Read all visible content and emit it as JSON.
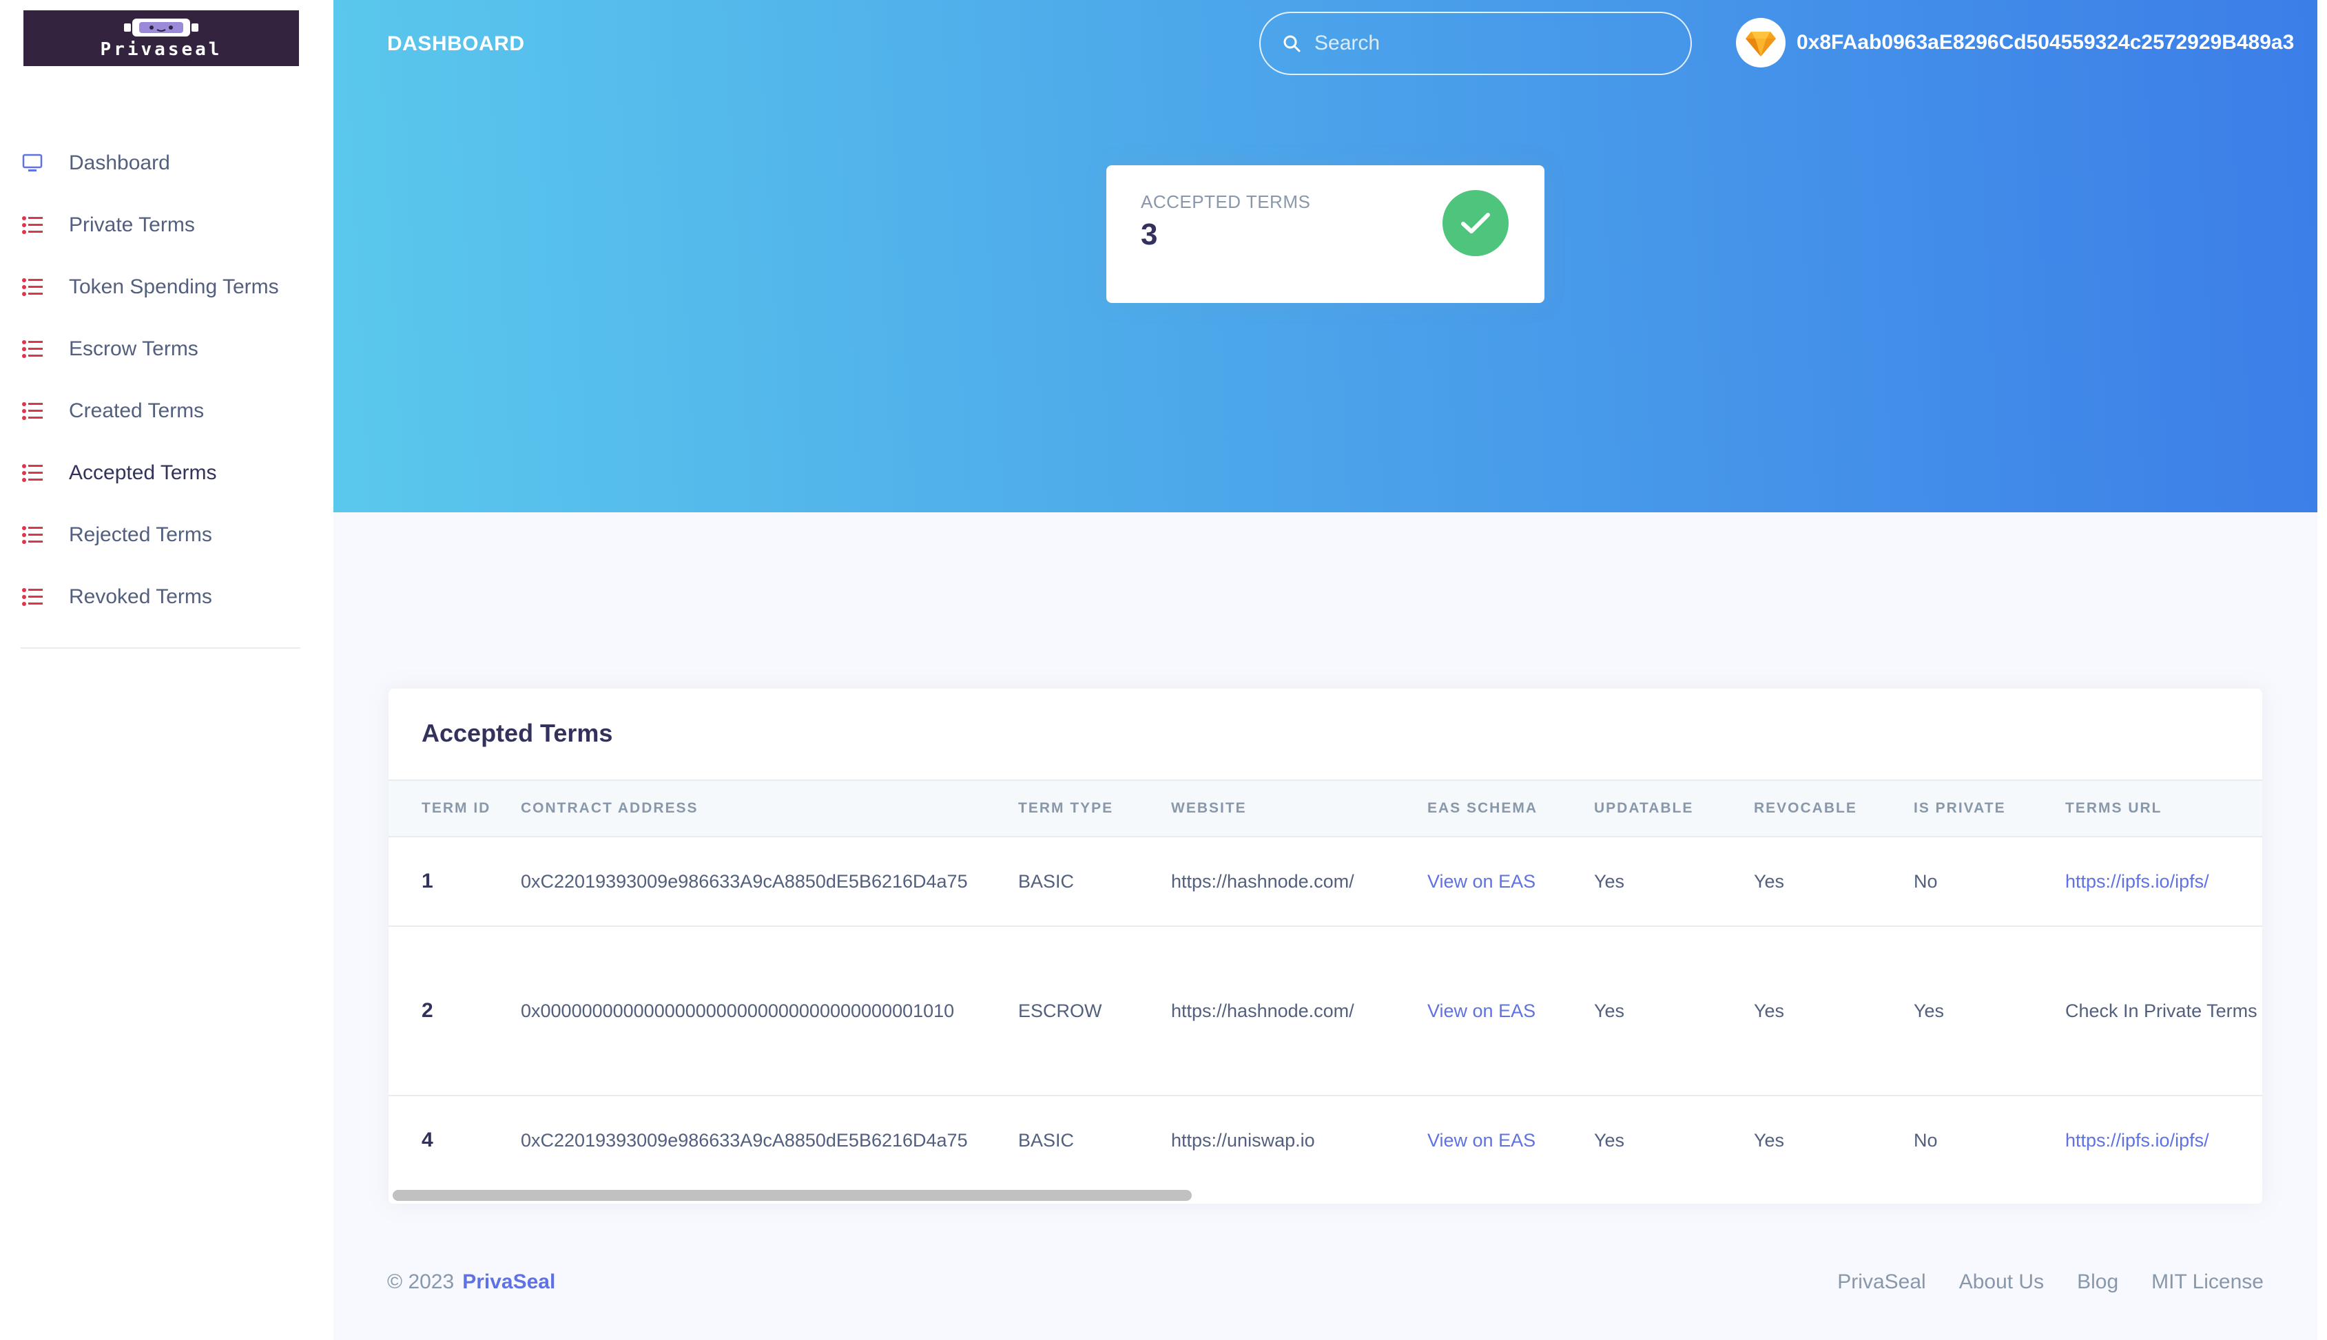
{
  "app": {
    "logo_text": "Privaseal"
  },
  "sidebar": {
    "items": [
      {
        "label": "Dashboard",
        "icon": "monitor-icon",
        "active": false
      },
      {
        "label": "Private Terms",
        "icon": "list-icon",
        "active": false
      },
      {
        "label": "Token Spending Terms",
        "icon": "list-icon",
        "active": false
      },
      {
        "label": "Escrow Terms",
        "icon": "list-icon",
        "active": false
      },
      {
        "label": "Created Terms",
        "icon": "list-icon",
        "active": false
      },
      {
        "label": "Accepted Terms",
        "icon": "list-icon",
        "active": true
      },
      {
        "label": "Rejected Terms",
        "icon": "list-icon",
        "active": false
      },
      {
        "label": "Revoked Terms",
        "icon": "list-icon",
        "active": false
      }
    ]
  },
  "header": {
    "title": "DASHBOARD",
    "search_placeholder": "Search",
    "account_address": "0x8FAab0963aE8296Cd504559324c2572929B489a3"
  },
  "stat": {
    "label": "ACCEPTED TERMS",
    "value": "3"
  },
  "table": {
    "title": "Accepted Terms",
    "columns": [
      "TERM ID",
      "CONTRACT ADDRESS",
      "TERM TYPE",
      "WEBSITE",
      "EAS SCHEMA",
      "UPDATABLE",
      "REVOCABLE",
      "IS PRIVATE",
      "TERMS URL"
    ],
    "rows": [
      [
        "1",
        "0xC22019393009e986633A9cA8850dE5B6216D4a75",
        "BASIC",
        "https://hashnode.com/",
        "View on EAS",
        "Yes",
        "Yes",
        "No",
        "https://ipfs.io/ipfs/"
      ],
      [
        "2",
        "0x0000000000000000000000000000000000001010",
        "ESCROW",
        "https://hashnode.com/",
        "View on EAS",
        "Yes",
        "Yes",
        "Yes",
        "Check In Private Terms"
      ],
      [
        "4",
        "0xC22019393009e986633A9cA8850dE5B6216D4a75",
        "BASIC",
        "https://uniswap.io",
        "View on EAS",
        "Yes",
        "Yes",
        "No",
        "https://ipfs.io/ipfs/"
      ]
    ]
  },
  "footer": {
    "copyright": "© 2023",
    "brand": "PrivaSeal",
    "links": [
      "PrivaSeal",
      "About Us",
      "Blog",
      "MIT License"
    ]
  },
  "colors": {
    "gradient_start": "#5ac8ec",
    "gradient_end": "#3c7ee8",
    "link": "#5e72e4",
    "success": "#4fc47d",
    "list_icon": "#e0344a",
    "logo_bg": "#33233f"
  }
}
